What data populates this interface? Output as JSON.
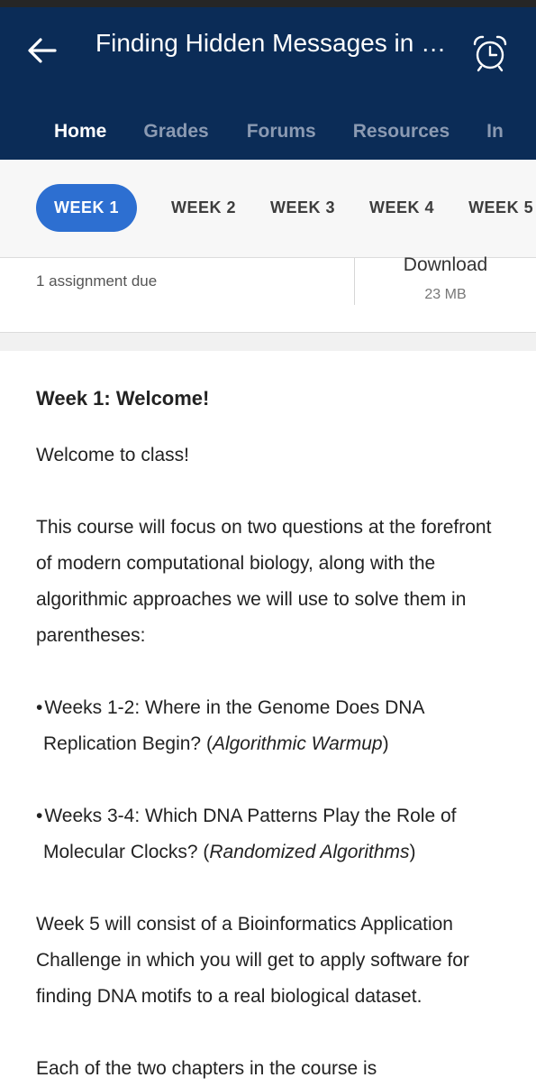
{
  "header": {
    "title": "Finding Hidden Messages in D...",
    "tabs": [
      "Home",
      "Grades",
      "Forums",
      "Resources",
      "In"
    ]
  },
  "weeks": [
    "WEEK 1",
    "WEEK 2",
    "WEEK 3",
    "WEEK 4",
    "WEEK 5"
  ],
  "info": {
    "assignment_due": "1 assignment due",
    "download_label": "Download",
    "download_size": "23 MB"
  },
  "content": {
    "heading": "Week 1: Welcome!",
    "p1": "Welcome to class!",
    "p2": "This course will focus on two questions at the forefront of modern computational biology, along with the algorithmic approaches we will use to solve them in parentheses:",
    "bullet1_text": "Weeks 1-2: Where in the Genome Does DNA Replication Begin? (",
    "bullet1_italic": "Algorithmic Warmup",
    "bullet1_end": ")",
    "bullet2_text": "Weeks 3-4: Which DNA Patterns Play the Role of Molecular Clocks? (",
    "bullet2_italic": "Randomized Algorithms",
    "bullet2_end": ")",
    "p3": "Week 5 will consist of a Bioinformatics Application Challenge in which you will get to apply software for finding DNA motifs to a real biological dataset.",
    "p4": "Each of the two chapters in the course is"
  },
  "colors": {
    "header": "#0b2c57",
    "accent": "#2d6fd1"
  },
  "icons": {
    "back": "arrow-left-icon",
    "alarm": "alarm-clock-icon"
  }
}
